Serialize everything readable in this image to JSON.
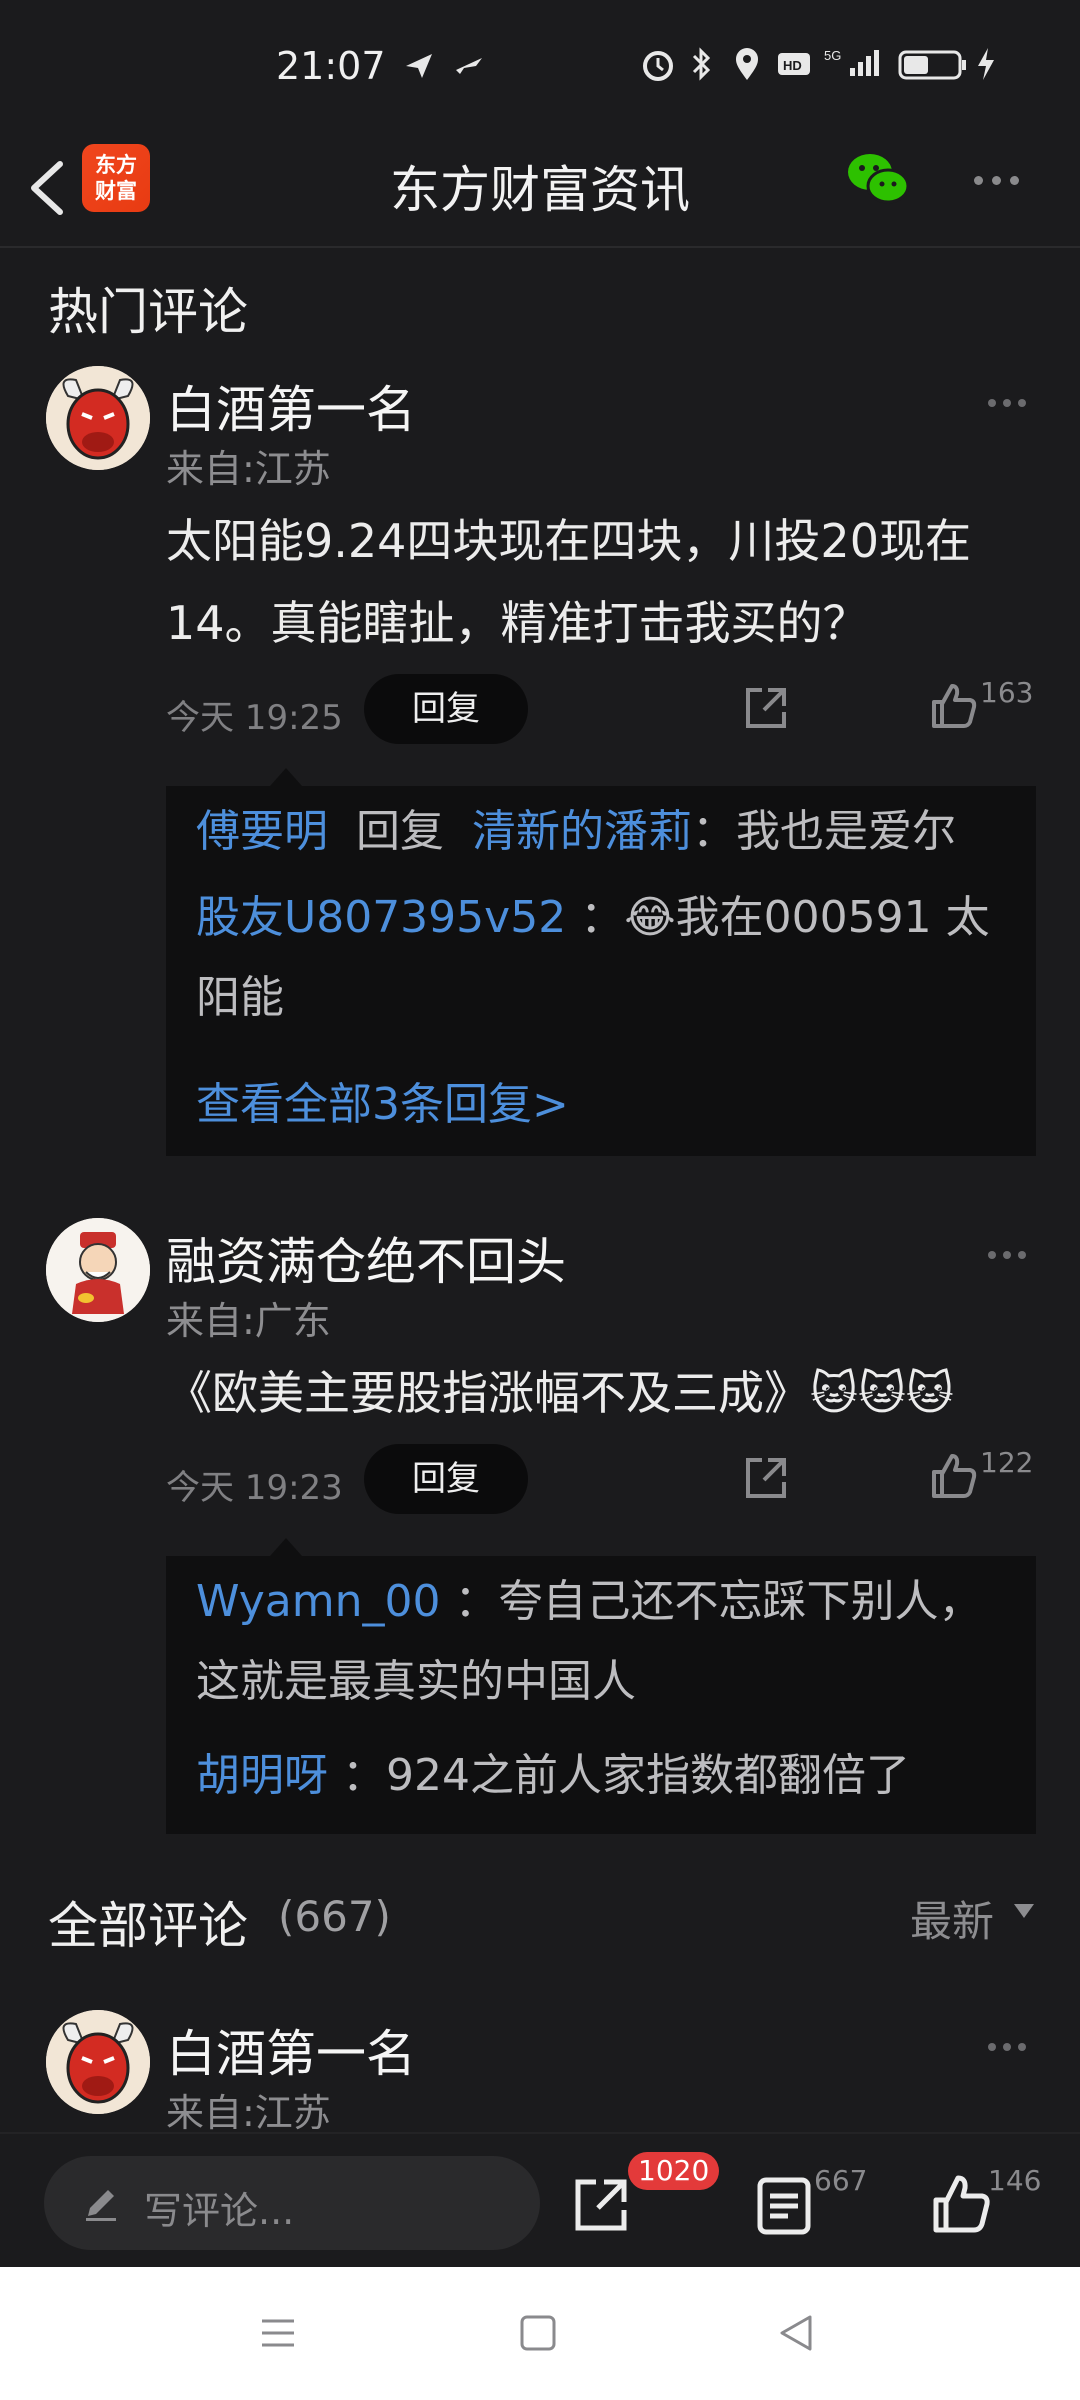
{
  "status_bar": {
    "time": "21:07"
  },
  "header": {
    "logo_text": "东方\n财富",
    "title": "东方财富资讯"
  },
  "hot": {
    "title": "热门评论",
    "comments": [
      {
        "username": "白酒第一名",
        "location": "来自:江苏",
        "content": "太阳能9.24四块现在四块，川投20现在14。真能瞎扯，精准打击我买的？",
        "time": "今天 19:25",
        "reply_label": "回复",
        "likes": "163",
        "replies": [
          {
            "name": "傅要明",
            "verb": "回复",
            "target": "清新的潘莉",
            "text": "：我也是爱尔"
          },
          {
            "name": "股友U807395v52",
            "text": "：😂我在000591 太阳能"
          }
        ],
        "view_all": "查看全部3条回复>"
      },
      {
        "username": "融资满仓绝不回头",
        "location": "来自:广东",
        "content": "《欧美主要股指涨幅不及三成》🐱🐱🐱",
        "time": "今天 19:23",
        "reply_label": "回复",
        "likes": "122",
        "replies": [
          {
            "name": "Wyamn_00",
            "text": "：夸自己还不忘踩下别人，这就是最真实的中国人"
          },
          {
            "name": "胡明呀",
            "text": "：924之前人家指数都翻倍了"
          }
        ]
      }
    ]
  },
  "all": {
    "title": "全部评论",
    "count": "(667)",
    "sort": "最新",
    "first": {
      "username": "白酒第一名",
      "location": "来自:江苏"
    }
  },
  "bottom_bar": {
    "placeholder": "写评论...",
    "share_badge": "1020",
    "comment_count": "667",
    "like_count": "146"
  },
  "colors": {
    "accent_blue": "#4d8fdc",
    "badge_red": "#e33a3a",
    "wechat_green": "#2dc100"
  }
}
